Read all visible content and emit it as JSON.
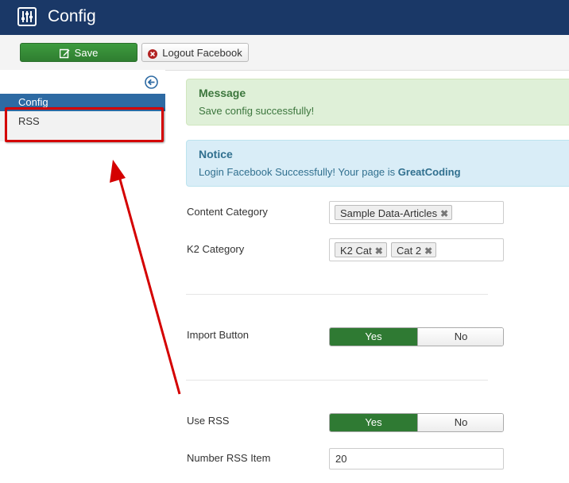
{
  "header": {
    "title": "Config",
    "icon": "sliders-icon"
  },
  "toolbar": {
    "save_label": "Save",
    "logout_label": "Logout Facebook"
  },
  "sidebar": {
    "items": [
      {
        "label": "Config",
        "active": true
      },
      {
        "label": "RSS",
        "active": false
      }
    ]
  },
  "alerts": {
    "success": {
      "heading": "Message",
      "text": "Save config successfully!"
    },
    "info": {
      "heading": "Notice",
      "text_prefix": "Login Facebook Successfully! Your page is ",
      "page_name": "GreatCoding"
    }
  },
  "form": {
    "content_category": {
      "label": "Content Category",
      "tags": [
        "Sample Data-Articles"
      ]
    },
    "k2_category": {
      "label": "K2 Category",
      "tags": [
        "K2 Cat",
        "Cat 2"
      ]
    },
    "import_button": {
      "label": "Import Button",
      "yes": "Yes",
      "no": "No",
      "value": "Yes"
    },
    "use_rss": {
      "label": "Use RSS",
      "yes": "Yes",
      "no": "No",
      "value": "Yes"
    },
    "number_rss_item": {
      "label": "Number RSS Item",
      "value": "20"
    }
  },
  "colors": {
    "header_bg": "#1a3867",
    "save_green": "#3d9b3f",
    "active_blue": "#2d6aa3",
    "annotation_red": "#d40000"
  }
}
